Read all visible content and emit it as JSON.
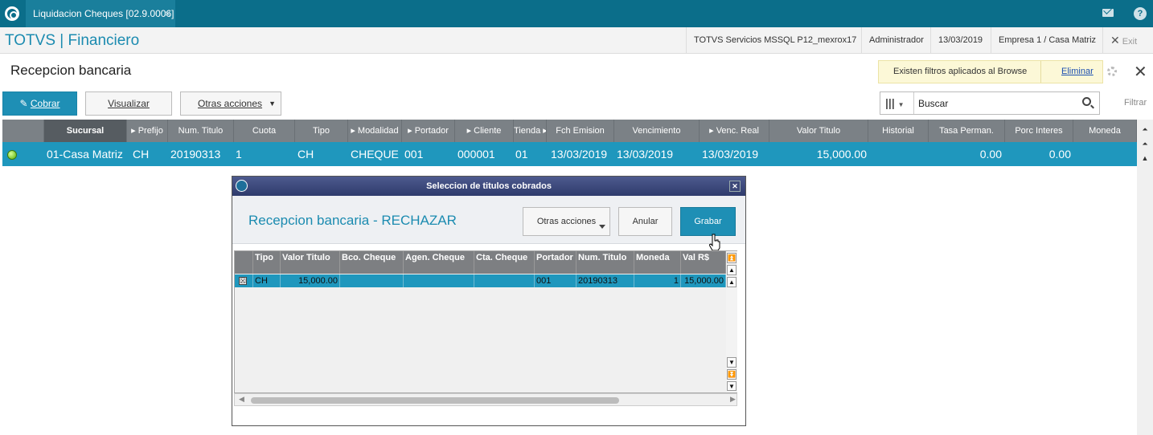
{
  "app": {
    "tab_title": "Liquidacion Cheques [02.9.0006]",
    "tab_close": "×",
    "brand": "TOTVS | Financiero",
    "header": {
      "server": "TOTVS Servicios MSSQL P12_mexrox17",
      "user": "Administrador",
      "date": "13/03/2019",
      "company": "Empresa 1 / Casa Matriz",
      "exit": "Exit"
    }
  },
  "page": {
    "title": "Recepcion bancaria",
    "filter_notice": "Existen filtros aplicados al Browse",
    "filter_remove": "Eliminar",
    "buttons": {
      "cobrar": "Cobrar",
      "visualizar": "Visualizar",
      "otras": "Otras acciones"
    },
    "search": {
      "placeholder": "Buscar",
      "filtrar": "Filtrar"
    }
  },
  "grid": {
    "columns": [
      "Sucursal",
      "Prefijo",
      "Num. Titulo",
      "Cuota",
      "Tipo",
      "Modalidad",
      "Portador",
      "Cliente",
      "Tienda",
      "Fch Emision",
      "Vencimiento",
      "Venc. Real",
      "Valor Titulo",
      "Historial",
      "Tasa Perman.",
      "Porc Interes",
      "Moneda"
    ],
    "row": {
      "sucursal": "01-Casa Matriz",
      "prefijo": "CH",
      "num_titulo": "20190313",
      "cuota": "1",
      "tipo": "CH",
      "modalidad": "CHEQUE",
      "portador": "001",
      "cliente": "000001",
      "tienda": "01",
      "fch_emision": "13/03/2019",
      "vencimiento": "13/03/2019",
      "venc_real": "13/03/2019",
      "valor_titulo": "15,000.00",
      "tasa_perman": "0.00",
      "porc_interes": "0.00",
      "status_color": "#55b000"
    }
  },
  "dialog": {
    "title": "Seleccion de titulos cobrados",
    "heading": "Recepcion bancaria - RECHAZAR",
    "buttons": {
      "otras": "Otras acciones",
      "anular": "Anular",
      "grabar": "Grabar"
    },
    "columns": [
      "Tipo",
      "Valor Titulo",
      "Bco. Cheque",
      "Agen. Cheque",
      "Cta. Cheque",
      "Portador",
      "Num. Titulo",
      "Moneda",
      "Val R$"
    ],
    "row": {
      "check": "☒",
      "tipo": "CH",
      "valor_titulo": "15,000.00",
      "bco_cheque": "",
      "agen_cheque": "",
      "cta_cheque": "",
      "portador": "001",
      "num_titulo": "20190313",
      "moneda": "1",
      "val_rs": "15,000.00"
    }
  },
  "colors": {
    "topbar": "#0b6e8a",
    "accent": "#1e8fb5",
    "selected_row": "#1f97bd"
  }
}
